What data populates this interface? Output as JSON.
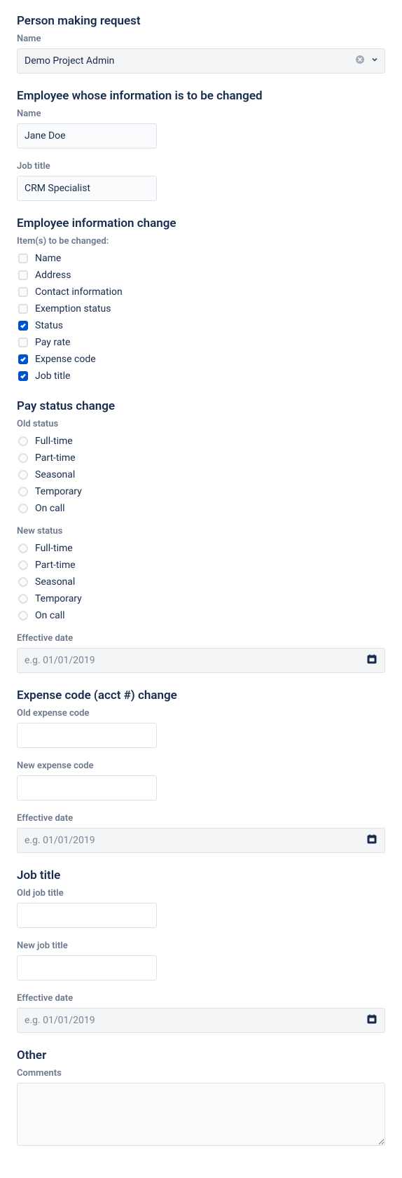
{
  "requester": {
    "section_title": "Person making request",
    "name_label": "Name",
    "name_value": "Demo Project Admin"
  },
  "employee": {
    "section_title": "Employee whose information is to be changed",
    "name_label": "Name",
    "name_value": "Jane Doe",
    "job_title_label": "Job title",
    "job_title_value": "CRM Specialist"
  },
  "info_change": {
    "section_title": "Employee information change",
    "items_label": "Item(s) to be changed:",
    "items": [
      {
        "label": "Name",
        "checked": false
      },
      {
        "label": "Address",
        "checked": false
      },
      {
        "label": "Contact information",
        "checked": false
      },
      {
        "label": "Exemption status",
        "checked": false
      },
      {
        "label": "Status",
        "checked": true
      },
      {
        "label": "Pay rate",
        "checked": false
      },
      {
        "label": "Expense code",
        "checked": true
      },
      {
        "label": "Job title",
        "checked": true
      }
    ]
  },
  "pay_status": {
    "section_title": "Pay status change",
    "old_label": "Old status",
    "new_label": "New status",
    "options": [
      {
        "label": "Full-time"
      },
      {
        "label": "Part-time"
      },
      {
        "label": "Seasonal"
      },
      {
        "label": "Temporary"
      },
      {
        "label": "On call"
      }
    ],
    "effective_label": "Effective date",
    "date_placeholder": "e.g. 01/01/2019"
  },
  "expense": {
    "section_title": "Expense code (acct #) change",
    "old_label": "Old expense code",
    "new_label": "New expense code",
    "effective_label": "Effective date",
    "date_placeholder": "e.g. 01/01/2019"
  },
  "job_title": {
    "section_title": "Job title",
    "old_label": "Old job title",
    "new_label": "New job title",
    "effective_label": "Effective date",
    "date_placeholder": "e.g. 01/01/2019"
  },
  "other": {
    "section_title": "Other",
    "comments_label": "Comments"
  }
}
